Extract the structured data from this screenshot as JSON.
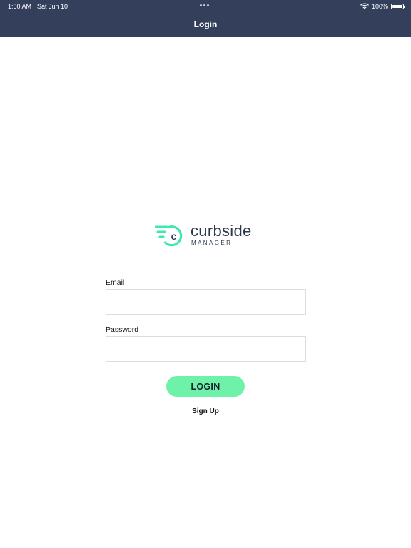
{
  "status_bar": {
    "time": "1:50 AM",
    "date": "Sat Jun 10",
    "battery": "100%"
  },
  "nav": {
    "title": "Login"
  },
  "logo": {
    "letter": "c",
    "word": "curbside",
    "sub": "MANAGER"
  },
  "form": {
    "email_label": "Email",
    "email_value": "",
    "password_label": "Password",
    "password_value": ""
  },
  "actions": {
    "login_label": "LOGIN",
    "signup_label": "Sign Up"
  },
  "colors": {
    "header_bg": "#333f5b",
    "brand_green": "#3ee8b0",
    "button_green": "#6ef1a9",
    "brand_text": "#2e3750"
  },
  "icons": {
    "wifi": "wifi-icon",
    "battery": "battery-icon",
    "logo": "curbside-logo-icon"
  }
}
